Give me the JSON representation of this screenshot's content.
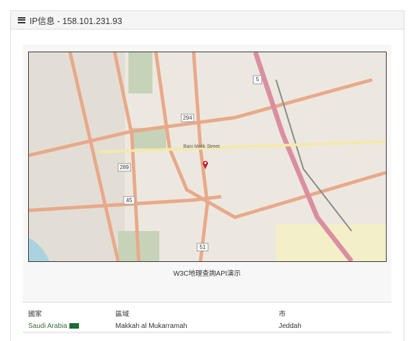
{
  "header": {
    "icon": "server-icon",
    "title": "IP信息 - 158.101.231.93"
  },
  "map": {
    "street_label": "Bani Malik Street",
    "road_numbers": [
      "294",
      "289",
      "45",
      "51",
      "5"
    ],
    "marker_color": "#c0262d",
    "caption": "W3C地理查詢API演示"
  },
  "info": {
    "country_label": "國家",
    "country": "Saudi Arabia",
    "flag": "saudi-arabia-flag",
    "region_label": "區域",
    "region": "Makkah al Mukarramah",
    "city_label": "市",
    "city": "Jeddah"
  }
}
